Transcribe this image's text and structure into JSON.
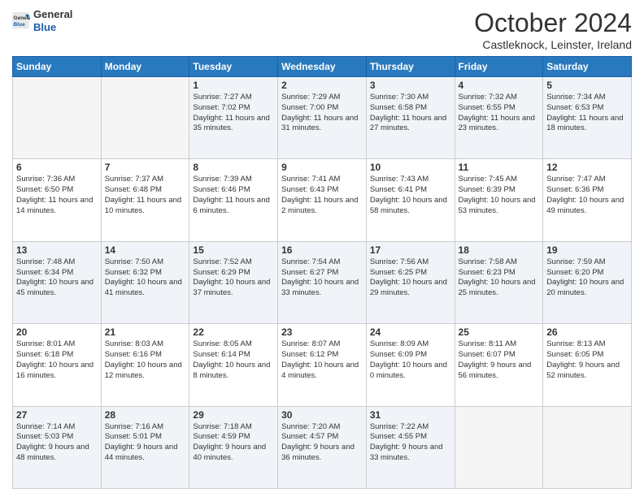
{
  "logo": {
    "general": "General",
    "blue": "Blue"
  },
  "header": {
    "month": "October 2024",
    "location": "Castleknock, Leinster, Ireland"
  },
  "days_of_week": [
    "Sunday",
    "Monday",
    "Tuesday",
    "Wednesday",
    "Thursday",
    "Friday",
    "Saturday"
  ],
  "weeks": [
    [
      {
        "day": "",
        "info": ""
      },
      {
        "day": "",
        "info": ""
      },
      {
        "day": "1",
        "info": "Sunrise: 7:27 AM\nSunset: 7:02 PM\nDaylight: 11 hours and 35 minutes."
      },
      {
        "day": "2",
        "info": "Sunrise: 7:29 AM\nSunset: 7:00 PM\nDaylight: 11 hours and 31 minutes."
      },
      {
        "day": "3",
        "info": "Sunrise: 7:30 AM\nSunset: 6:58 PM\nDaylight: 11 hours and 27 minutes."
      },
      {
        "day": "4",
        "info": "Sunrise: 7:32 AM\nSunset: 6:55 PM\nDaylight: 11 hours and 23 minutes."
      },
      {
        "day": "5",
        "info": "Sunrise: 7:34 AM\nSunset: 6:53 PM\nDaylight: 11 hours and 18 minutes."
      }
    ],
    [
      {
        "day": "6",
        "info": "Sunrise: 7:36 AM\nSunset: 6:50 PM\nDaylight: 11 hours and 14 minutes."
      },
      {
        "day": "7",
        "info": "Sunrise: 7:37 AM\nSunset: 6:48 PM\nDaylight: 11 hours and 10 minutes."
      },
      {
        "day": "8",
        "info": "Sunrise: 7:39 AM\nSunset: 6:46 PM\nDaylight: 11 hours and 6 minutes."
      },
      {
        "day": "9",
        "info": "Sunrise: 7:41 AM\nSunset: 6:43 PM\nDaylight: 11 hours and 2 minutes."
      },
      {
        "day": "10",
        "info": "Sunrise: 7:43 AM\nSunset: 6:41 PM\nDaylight: 10 hours and 58 minutes."
      },
      {
        "day": "11",
        "info": "Sunrise: 7:45 AM\nSunset: 6:39 PM\nDaylight: 10 hours and 53 minutes."
      },
      {
        "day": "12",
        "info": "Sunrise: 7:47 AM\nSunset: 6:36 PM\nDaylight: 10 hours and 49 minutes."
      }
    ],
    [
      {
        "day": "13",
        "info": "Sunrise: 7:48 AM\nSunset: 6:34 PM\nDaylight: 10 hours and 45 minutes."
      },
      {
        "day": "14",
        "info": "Sunrise: 7:50 AM\nSunset: 6:32 PM\nDaylight: 10 hours and 41 minutes."
      },
      {
        "day": "15",
        "info": "Sunrise: 7:52 AM\nSunset: 6:29 PM\nDaylight: 10 hours and 37 minutes."
      },
      {
        "day": "16",
        "info": "Sunrise: 7:54 AM\nSunset: 6:27 PM\nDaylight: 10 hours and 33 minutes."
      },
      {
        "day": "17",
        "info": "Sunrise: 7:56 AM\nSunset: 6:25 PM\nDaylight: 10 hours and 29 minutes."
      },
      {
        "day": "18",
        "info": "Sunrise: 7:58 AM\nSunset: 6:23 PM\nDaylight: 10 hours and 25 minutes."
      },
      {
        "day": "19",
        "info": "Sunrise: 7:59 AM\nSunset: 6:20 PM\nDaylight: 10 hours and 20 minutes."
      }
    ],
    [
      {
        "day": "20",
        "info": "Sunrise: 8:01 AM\nSunset: 6:18 PM\nDaylight: 10 hours and 16 minutes."
      },
      {
        "day": "21",
        "info": "Sunrise: 8:03 AM\nSunset: 6:16 PM\nDaylight: 10 hours and 12 minutes."
      },
      {
        "day": "22",
        "info": "Sunrise: 8:05 AM\nSunset: 6:14 PM\nDaylight: 10 hours and 8 minutes."
      },
      {
        "day": "23",
        "info": "Sunrise: 8:07 AM\nSunset: 6:12 PM\nDaylight: 10 hours and 4 minutes."
      },
      {
        "day": "24",
        "info": "Sunrise: 8:09 AM\nSunset: 6:09 PM\nDaylight: 10 hours and 0 minutes."
      },
      {
        "day": "25",
        "info": "Sunrise: 8:11 AM\nSunset: 6:07 PM\nDaylight: 9 hours and 56 minutes."
      },
      {
        "day": "26",
        "info": "Sunrise: 8:13 AM\nSunset: 6:05 PM\nDaylight: 9 hours and 52 minutes."
      }
    ],
    [
      {
        "day": "27",
        "info": "Sunrise: 7:14 AM\nSunset: 5:03 PM\nDaylight: 9 hours and 48 minutes."
      },
      {
        "day": "28",
        "info": "Sunrise: 7:16 AM\nSunset: 5:01 PM\nDaylight: 9 hours and 44 minutes."
      },
      {
        "day": "29",
        "info": "Sunrise: 7:18 AM\nSunset: 4:59 PM\nDaylight: 9 hours and 40 minutes."
      },
      {
        "day": "30",
        "info": "Sunrise: 7:20 AM\nSunset: 4:57 PM\nDaylight: 9 hours and 36 minutes."
      },
      {
        "day": "31",
        "info": "Sunrise: 7:22 AM\nSunset: 4:55 PM\nDaylight: 9 hours and 33 minutes."
      },
      {
        "day": "",
        "info": ""
      },
      {
        "day": "",
        "info": ""
      }
    ]
  ]
}
